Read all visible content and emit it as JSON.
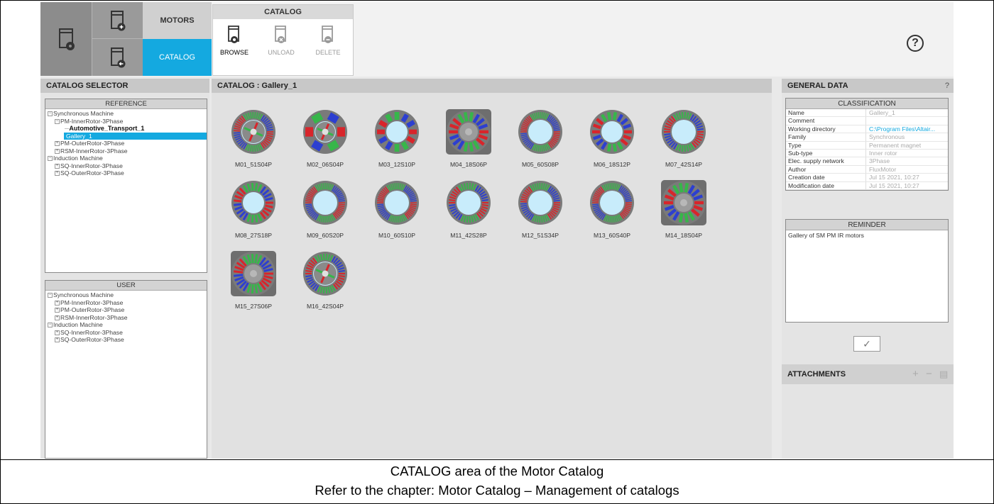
{
  "ribbon": {
    "modules": {
      "motors_label": "MOTORS",
      "catalog_label": "CATALOG"
    },
    "group_title": "CATALOG",
    "buttons": [
      {
        "label": "BROWSE",
        "enabled": true
      },
      {
        "label": "UNLOAD",
        "enabled": false
      },
      {
        "label": "DELETE",
        "enabled": false
      }
    ],
    "help": "?"
  },
  "left": {
    "title": "CATALOG SELECTOR",
    "reference": {
      "title": "REFERENCE",
      "items": [
        "Synchronous Machine",
        "PM-InnerRotor-3Phase",
        "Automotive_Transport_1",
        "Gallery_1",
        "PM-OuterRotor-3Phase",
        "RSM-InnerRotor-3Phase",
        "Induction Machine",
        "SQ-InnerRotor-3Phase",
        "SQ-OuterRotor-3Phase"
      ]
    },
    "user": {
      "title": "USER",
      "items": [
        "Synchronous Machine",
        "PM-InnerRotor-3Phase",
        "PM-OuterRotor-3Phase",
        "RSM-InnerRotor-3Phase",
        "Induction Machine",
        "SQ-InnerRotor-3Phase",
        "SQ-OuterRotor-3Phase"
      ]
    }
  },
  "center": {
    "title": "CATALOG : Gallery_1",
    "motors": [
      "M01_51S04P",
      "M02_06S04P",
      "M03_12S10P",
      "M04_18S06P",
      "M05_60S08P",
      "M06_18S12P",
      "M07_42S14P",
      "M08_27S18P",
      "M09_60S20P",
      "M10_60S10P",
      "M11_42S28P",
      "M12_51S34P",
      "M13_60S40P",
      "M14_18S04P",
      "M15_27S06P",
      "M16_42S04P"
    ]
  },
  "right": {
    "title": "GENERAL DATA",
    "help": "?",
    "classification": {
      "title": "CLASSIFICATION",
      "rows": [
        {
          "key": "Name",
          "value": "Gallery_1"
        },
        {
          "key": "Comment",
          "value": ""
        },
        {
          "key": "Working directory",
          "value": "C:\\Program Files\\Altair..."
        },
        {
          "key": "Family",
          "value": "Synchronous"
        },
        {
          "key": "Type",
          "value": "Permanent magnet"
        },
        {
          "key": "Sub-type",
          "value": "Inner rotor"
        },
        {
          "key": "Elec. supply network",
          "value": "3Phase"
        },
        {
          "key": "Author",
          "value": "FluxMotor"
        },
        {
          "key": "Creation date",
          "value": "Jul 15 2021, 10:27"
        },
        {
          "key": "Modification date",
          "value": "Jul 15 2021, 10:27"
        }
      ]
    },
    "reminder": {
      "title": "REMINDER",
      "text": "Gallery of SM PM IR motors"
    },
    "attachments_title": "ATTACHMENTS"
  },
  "caption": {
    "line1": "CATALOG area of the Motor Catalog",
    "line2": "Refer to the chapter: Motor Catalog – Management of catalogs"
  },
  "colors": {
    "accent": "#14a9e0",
    "coil_red": "#d8252b",
    "coil_green": "#37b64a",
    "coil_blue": "#2d3fd0",
    "bore": "#c8ecfb"
  }
}
